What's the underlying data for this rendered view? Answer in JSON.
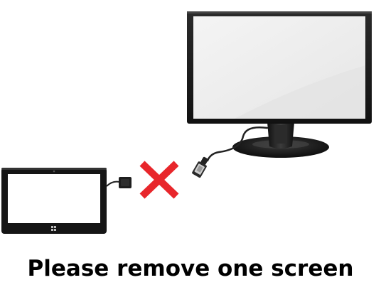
{
  "message": {
    "text": "Please remove one screen"
  },
  "illustration": {
    "icons": [
      "tablet-icon",
      "disconnected-cross-icon",
      "monitor-icon",
      "video-cable-icon"
    ],
    "cross_color": "#e8262b",
    "device_color": "#1a1a1a",
    "screen_color": "#f0f0f0"
  }
}
